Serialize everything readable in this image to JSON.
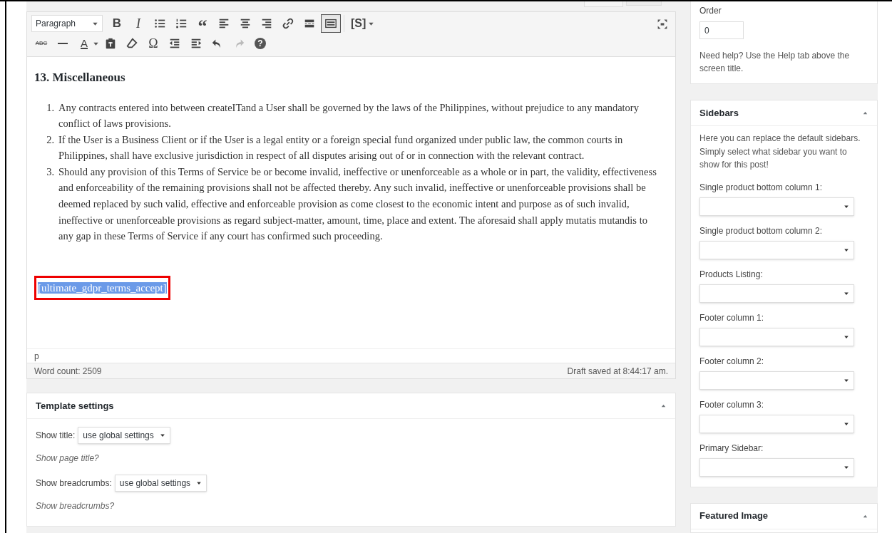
{
  "editor": {
    "format_select": "Paragraph",
    "toolbar_rows": [
      [
        {
          "kind": "bold",
          "text": "B",
          "pressed": false,
          "disabled": false
        },
        {
          "kind": "italic",
          "text": "I",
          "pressed": false,
          "disabled": false
        },
        {
          "kind": "bullet-list",
          "pressed": false,
          "disabled": false
        },
        {
          "kind": "numbered-list",
          "pressed": false,
          "disabled": false
        },
        {
          "kind": "quote",
          "text": "“",
          "pressed": false,
          "disabled": false
        },
        {
          "kind": "align-left",
          "pressed": false,
          "disabled": false
        },
        {
          "kind": "align-center",
          "pressed": false,
          "disabled": false
        },
        {
          "kind": "align-right",
          "pressed": false,
          "disabled": false
        },
        {
          "kind": "link",
          "pressed": false,
          "disabled": false
        },
        {
          "kind": "read-more",
          "pressed": false,
          "disabled": false
        },
        {
          "kind": "toolbar-toggle",
          "pressed": true,
          "disabled": false
        },
        {
          "kind": "shortcode",
          "text": "[S]",
          "pressed": false,
          "disabled": false
        }
      ],
      [
        {
          "kind": "strikethrough",
          "text": "ABC",
          "pressed": false,
          "disabled": false
        },
        {
          "kind": "horizontal-line",
          "pressed": false,
          "disabled": false
        },
        {
          "kind": "text-color",
          "text": "A",
          "pressed": false,
          "disabled": false
        },
        {
          "kind": "paste-text",
          "pressed": false,
          "disabled": false
        },
        {
          "kind": "eraser",
          "pressed": false,
          "disabled": false
        },
        {
          "kind": "special-character",
          "text": "Ω",
          "pressed": false,
          "disabled": false
        },
        {
          "kind": "outdent",
          "pressed": false,
          "disabled": false
        },
        {
          "kind": "indent",
          "pressed": false,
          "disabled": false
        },
        {
          "kind": "undo",
          "pressed": false,
          "disabled": false
        },
        {
          "kind": "redo",
          "pressed": false,
          "disabled": true
        },
        {
          "kind": "help",
          "text": "?",
          "pressed": false,
          "disabled": false
        }
      ]
    ],
    "heading": "13. Miscellaneous",
    "list_numbers": [
      "1.",
      "2.",
      "3."
    ],
    "list_items": [
      "Any contracts entered into between createITand a User shall be governed by the laws of the Philippines, without prejudice to any mandatory conflict of laws provisions.",
      "If the User is a Business Client or if the User is a legal entity or a foreign special fund organized under public law, the common courts in Philippines, shall have exclusive jurisdiction in respect of all disputes arising out of or in connection with the relevant contract.",
      "Should any provision of this Terms of Service be or become invalid, ineffective or unenforceable as a whole or in part, the validity, effectiveness and enforceability of the remaining provisions shall not be affected thereby. Any such invalid, ineffective or unenforceable provisions shall be deemed replaced by such valid, effective and enforceable provision as come closest to the economic intent and purpose as of such invalid, ineffective or unenforceable provisions as regard subject-matter, amount, time, place and extent. The aforesaid shall apply mutatis mutandis to any gap in these Terms of Service if any court has confirmed such proceeding."
    ],
    "shortcode": {
      "text": "[ultimate_gdpr_terms_accept]",
      "selected": true
    },
    "path": "p",
    "word_count": "Word count: 2509",
    "draft_status": "Draft saved at 8:44:17 am."
  },
  "template_settings": {
    "title": "Template settings",
    "expanded": true,
    "fields": [
      {
        "label": "Show title:",
        "value": "use global settings",
        "help": "Show page title?"
      },
      {
        "label": "Show breadcrumbs:",
        "value": "use global settings",
        "help": "Show breadcrumbs?"
      }
    ]
  },
  "order_panel": {
    "label": "Order",
    "value": "0",
    "help": "Need help? Use the Help tab above the screen title."
  },
  "sidebars_panel": {
    "title": "Sidebars",
    "expanded": true,
    "description": "Here you can replace the default sidebars. Simply select what sidebar you want to show for this post!",
    "selects": [
      "Single product bottom column 1:",
      "Single product bottom column 2:",
      "Products Listing:",
      "Footer column 1:",
      "Footer column 2:",
      "Footer column 3:",
      "Primary Sidebar:"
    ]
  },
  "featured_image_panel": {
    "title": "Featured Image",
    "expanded": true
  }
}
